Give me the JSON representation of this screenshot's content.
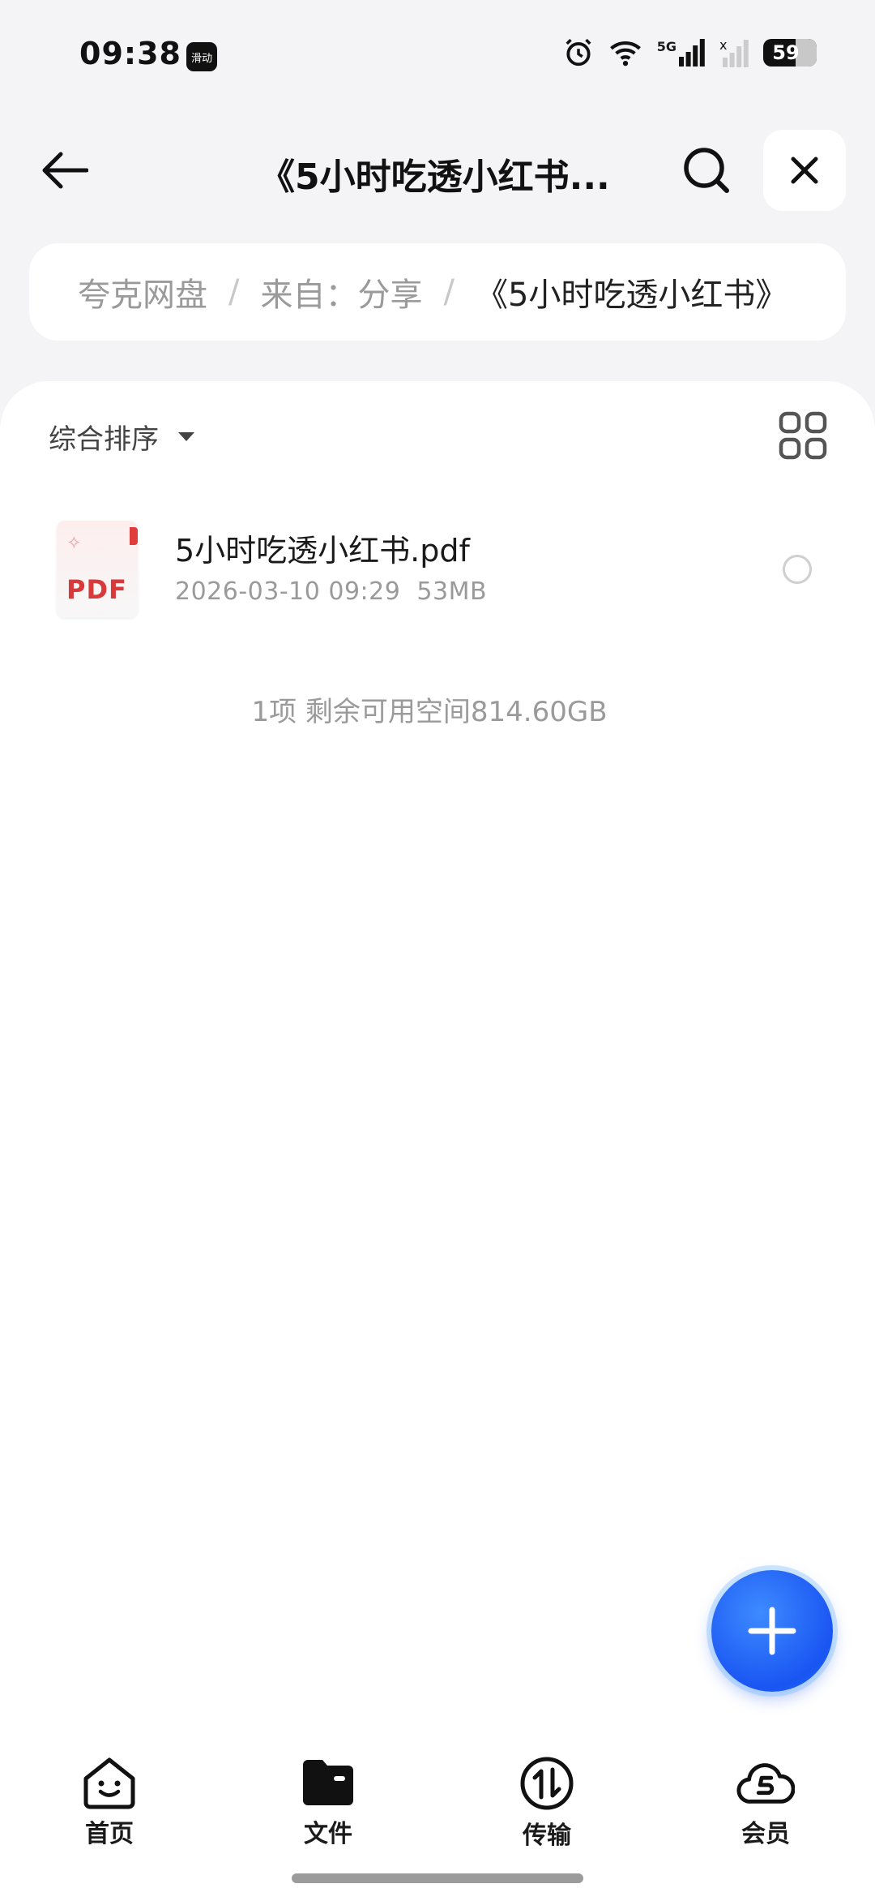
{
  "status_bar": {
    "time": "09:38",
    "app_badge": "滑动",
    "battery": "59",
    "network": "5G"
  },
  "header": {
    "title": "《5小时吃透小红书...",
    "back_icon": "arrow-left-icon",
    "search_icon": "search-icon",
    "close_icon": "close-icon"
  },
  "breadcrumb": {
    "items": [
      "夸克网盘",
      "来自：分享",
      "《5小时吃透小红书》"
    ],
    "separator": "/"
  },
  "toolbar": {
    "sort_label": "综合排序",
    "grid_icon": "grid-view-icon"
  },
  "files": [
    {
      "name": "5小时吃透小红书.pdf",
      "type_label": "PDF",
      "date": "2026-03-10 09:29",
      "size": "53MB"
    }
  ],
  "summary": "1项 剩余可用空间814.60GB",
  "fab": {
    "icon": "plus-icon"
  },
  "nav": {
    "items": [
      {
        "label": "首页",
        "icon": "home-icon"
      },
      {
        "label": "文件",
        "icon": "folder-icon"
      },
      {
        "label": "传输",
        "icon": "transfer-icon"
      },
      {
        "label": "会员",
        "icon": "vip-cloud-icon"
      }
    ]
  },
  "colors": {
    "accent": "#1a55f2",
    "background": "#f4f4f6",
    "pdf_red": "#d8393b"
  }
}
